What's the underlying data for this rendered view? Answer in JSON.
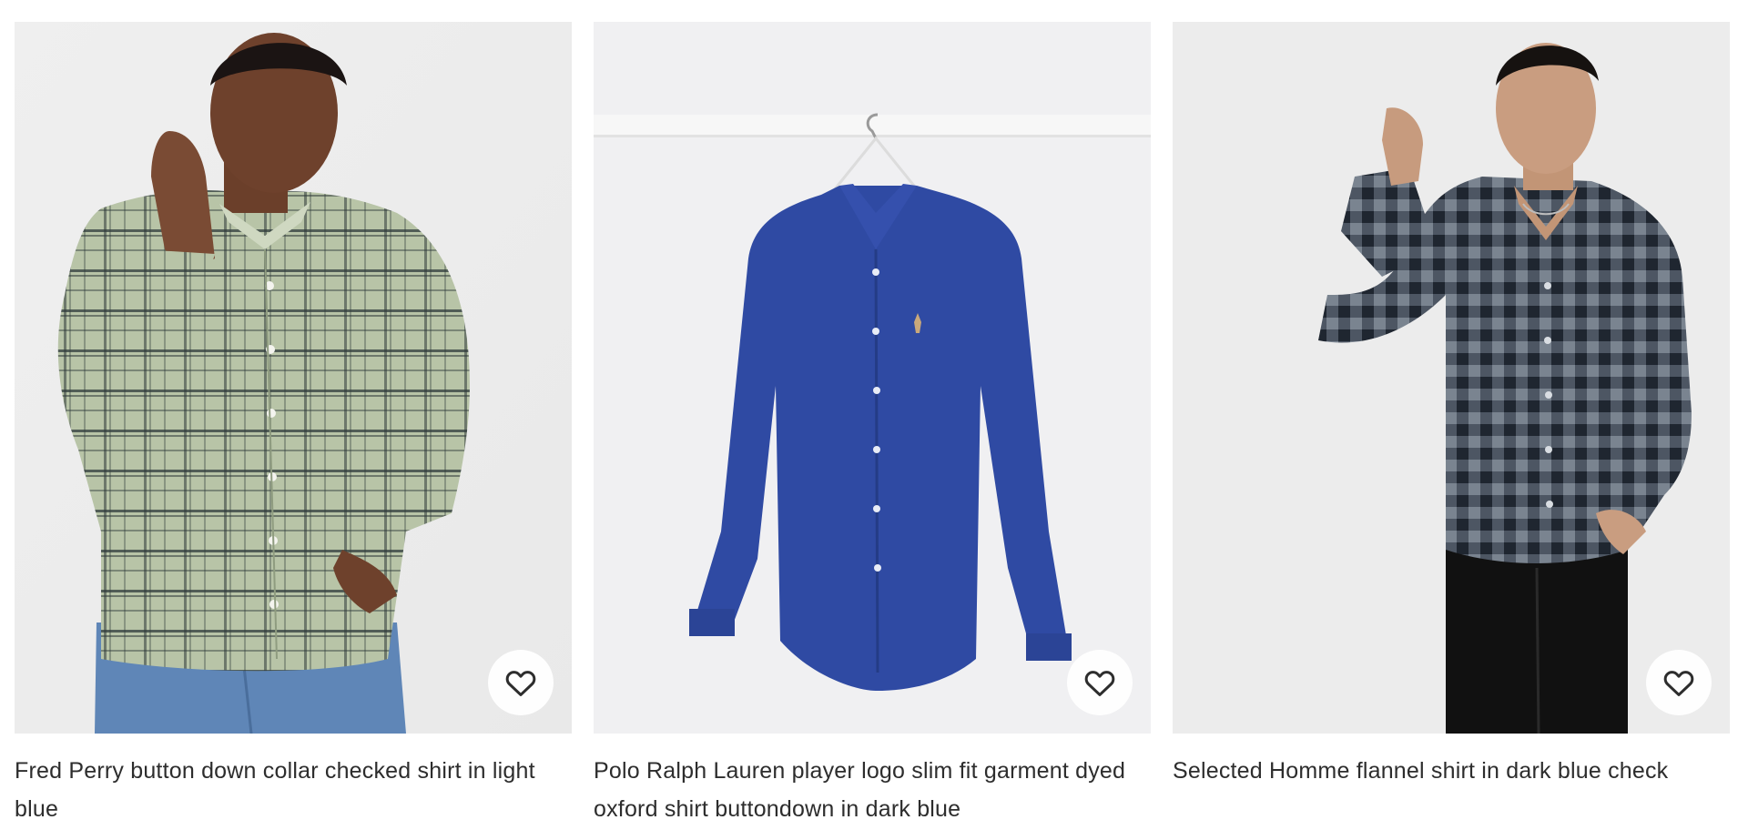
{
  "products": [
    {
      "title": "Fred Perry button down collar checked shirt in light blue",
      "image_alt": "model wearing sage green checked shirt",
      "wishlist_icon": "heart-outline-icon"
    },
    {
      "title": "Polo Ralph Lauren player logo slim fit garment dyed oxford shirt buttondown in dark blue",
      "image_alt": "dark blue shirt on hanger",
      "wishlist_icon": "heart-outline-icon"
    },
    {
      "title": "Selected Homme flannel shirt in dark blue check",
      "image_alt": "model wearing dark gingham flannel shirt",
      "wishlist_icon": "heart-outline-icon"
    }
  ],
  "colors": {
    "image_bg": "#eeeeee",
    "text": "#2d2d2d",
    "shirt1": "#b7c3a6",
    "shirt2": "#2f4aa0",
    "shirt3": "#3b4450"
  }
}
